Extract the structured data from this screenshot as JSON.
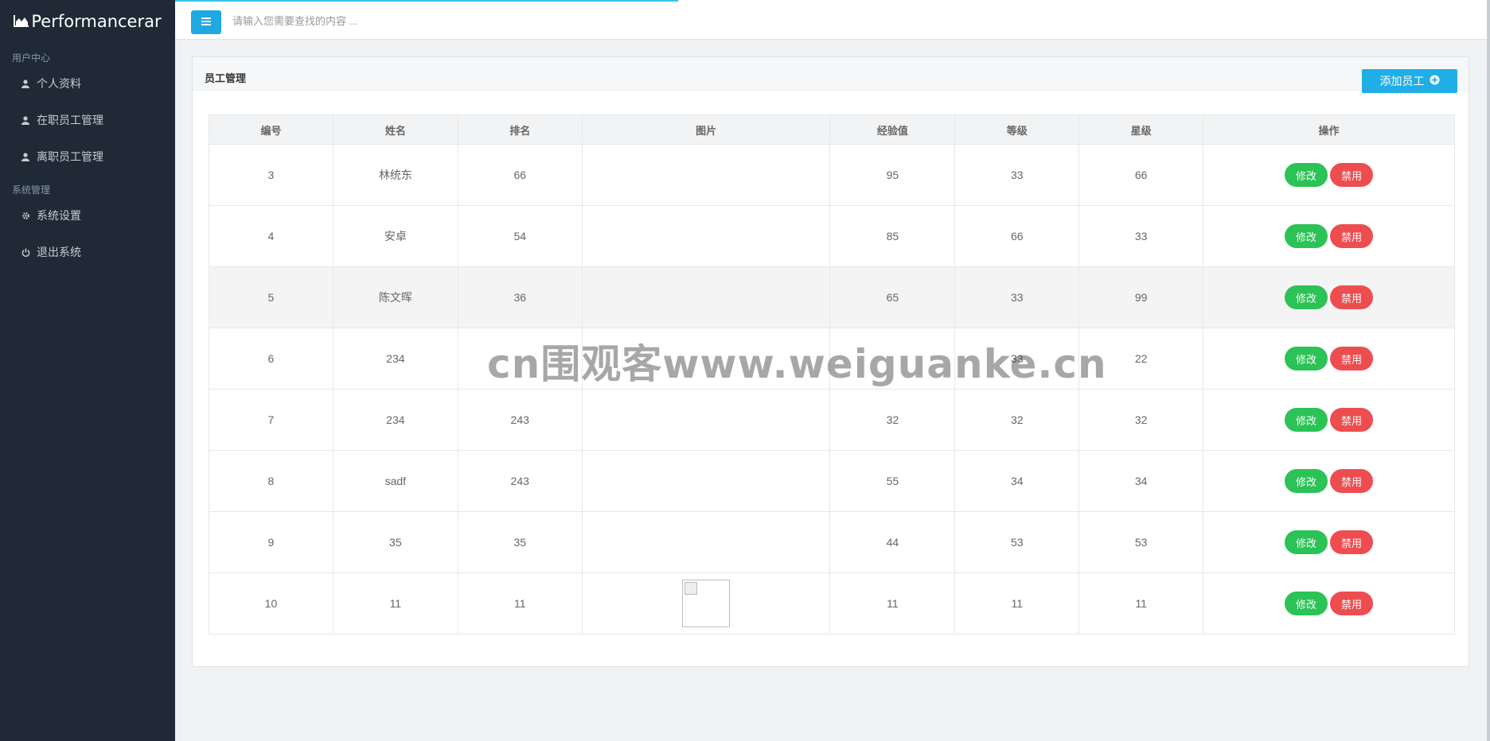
{
  "brand": {
    "name": "Performancerar"
  },
  "sidebar": {
    "groups": [
      {
        "title": "用户中心",
        "items": [
          {
            "label": "个人资料",
            "icon": "user-icon"
          },
          {
            "label": "在职员工管理",
            "icon": "user-icon"
          },
          {
            "label": "离职员工管理",
            "icon": "user-icon"
          }
        ]
      },
      {
        "title": "系统管理",
        "items": [
          {
            "label": "系统设置",
            "icon": "gear-icon"
          },
          {
            "label": "退出系统",
            "icon": "power-icon"
          }
        ]
      }
    ]
  },
  "header": {
    "search_placeholder": "请输入您需要查找的内容 ..."
  },
  "panel": {
    "title": "员工管理",
    "add_button": "添加员工"
  },
  "table": {
    "columns": [
      "编号",
      "姓名",
      "排名",
      "图片",
      "经验值",
      "等级",
      "星级",
      "操作"
    ],
    "rows": [
      [
        "3",
        "林统东",
        "66",
        "",
        "95",
        "33",
        "66"
      ],
      [
        "4",
        "安卓",
        "54",
        "",
        "85",
        "66",
        "33"
      ],
      [
        "5",
        "陈文晖",
        "36",
        "",
        "65",
        "33",
        "99"
      ],
      [
        "6",
        "234",
        "",
        "",
        "",
        "33",
        "22"
      ],
      [
        "7",
        "234",
        "243",
        "",
        "32",
        "32",
        "32"
      ],
      [
        "8",
        "sadf",
        "243",
        "",
        "55",
        "34",
        "34"
      ],
      [
        "9",
        "35",
        "35",
        "",
        "44",
        "53",
        "53"
      ],
      [
        "10",
        "11",
        "11",
        "",
        "11",
        "11",
        "11"
      ]
    ],
    "edit_label": "修改",
    "ban_label": "禁用"
  },
  "watermark": "cn围观客www.weiguanke.cn",
  "colors": {
    "sidebar_bg": "#1f2a36",
    "accent": "#20aee6",
    "edit": "#2bc256",
    "ban": "#ee4d4f"
  }
}
